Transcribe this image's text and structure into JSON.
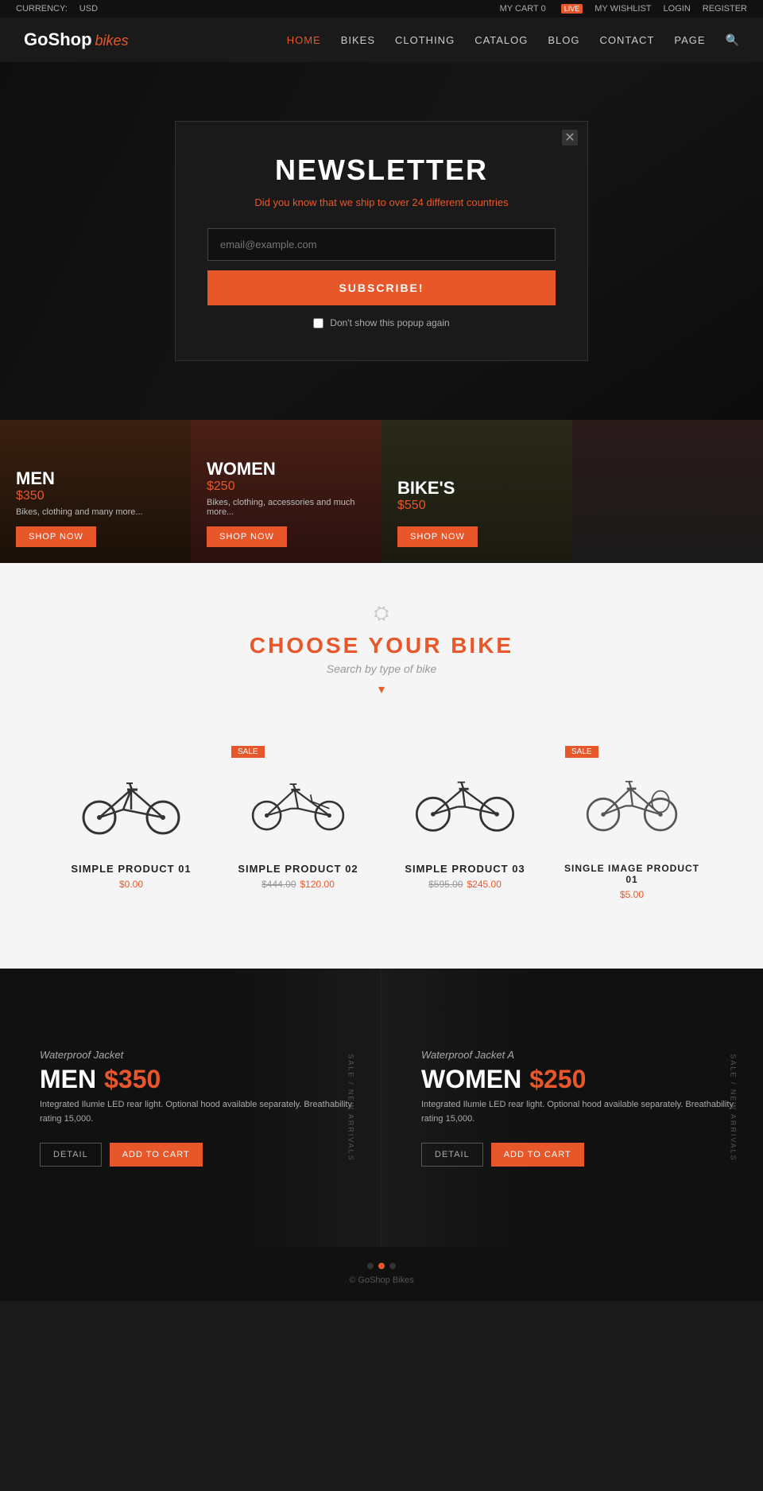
{
  "topbar": {
    "currency_label": "CURRENCY:",
    "currency_value": "USD",
    "cart_label": "MY CART",
    "cart_count": "0",
    "wishlist_label": "MY WISHLIST",
    "login_label": "LOGIN",
    "register_label": "REGISTER",
    "live_badge": "LIVE"
  },
  "header": {
    "logo_main": "GoShop",
    "logo_sub": "bikes",
    "nav_items": [
      {
        "label": "HOME",
        "active": true
      },
      {
        "label": "BIKES",
        "active": false
      },
      {
        "label": "CLOTHING",
        "active": false
      },
      {
        "label": "CATALOG",
        "active": false
      },
      {
        "label": "BLOG",
        "active": false
      },
      {
        "label": "CONTACT",
        "active": false
      },
      {
        "label": "PAGE",
        "active": false
      }
    ]
  },
  "modal": {
    "title": "NEWSLETTER",
    "subtitle": "Did you know that we ship to over",
    "subtitle_highlight": "24 different countries",
    "email_placeholder": "email@example.com",
    "subscribe_label": "SUBSCRIBE!",
    "dont_show_label": "Don't show this popup again"
  },
  "categories": [
    {
      "label": "MEN",
      "price": "$350",
      "desc": "Bikes, clothing and many more...",
      "btn": "SHOP NOW"
    },
    {
      "label": "WOMEN",
      "price": "$250",
      "desc": "Bikes, clothing, accessories and much more...",
      "btn": "SHOP NOW"
    },
    {
      "label": "BIKE'S",
      "price": "$550",
      "desc": "",
      "btn": "SHOP NOW"
    },
    {
      "label": "",
      "price": "",
      "desc": "",
      "btn": ""
    }
  ],
  "choose_section": {
    "title_regular": "CHOOSE YOUR",
    "title_highlight": "BIKE",
    "subtitle": "Search by type of bike",
    "arrow": "▾"
  },
  "products": [
    {
      "name": "SIMPLE PRODUCT 01",
      "old_price": "",
      "new_price": "$0.00",
      "sale": false
    },
    {
      "name": "SIMPLE PRODUCT 02",
      "old_price": "$444.00",
      "new_price": "$120.00",
      "sale": true
    },
    {
      "name": "SIMPLE PRODUCT 03",
      "old_price": "$595.00",
      "new_price": "$245.00",
      "sale": false
    },
    {
      "name": "SINGLE IMAGE PRODUCT 01",
      "old_price": "",
      "new_price": "$5.00",
      "sale": true
    }
  ],
  "featured": [
    {
      "tag": "Waterproof Jacket",
      "title": "MEN",
      "price": "$350",
      "desc": "Integrated Ilumie LED rear light. Optional hood available separately. Breathability rating 15,000.",
      "detail_btn": "DETAIL",
      "cart_btn": "ADD TO CART",
      "vertical_label": "Sale / New arrivals"
    },
    {
      "tag": "Waterproof Jacket A",
      "title": "WOMEN",
      "price": "$250",
      "desc": "Integrated Ilumie LED rear light. Optional hood available separately. Breathability rating 15,000.",
      "detail_btn": "DETAIL",
      "cart_btn": "ADD TO CART",
      "vertical_label": "Sale / New arrivals"
    }
  ],
  "footer": {
    "dots_count": 3,
    "active_dot": 1
  }
}
